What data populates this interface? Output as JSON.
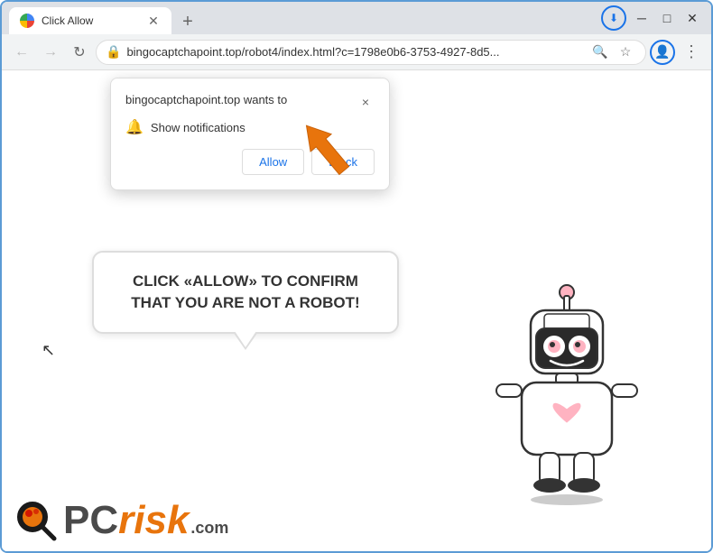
{
  "browser": {
    "tab": {
      "title": "Click Allow",
      "favicon_alt": "tab-favicon"
    },
    "new_tab_button": "+",
    "window_controls": {
      "minimize": "─",
      "maximize": "□",
      "close": "✕"
    },
    "address_bar": {
      "url": "bingocaptchapoint.top/robot4/index.html?c=1798e0b6-3753-4927-8d5...",
      "lock_icon": "🔒"
    },
    "nav": {
      "back": "←",
      "forward": "→",
      "refresh": "↻"
    }
  },
  "notification_popup": {
    "site_text": "bingocaptchapoint.top wants to",
    "close_icon": "×",
    "notification_label": "Show notifications",
    "allow_button": "Allow",
    "block_button": "Block"
  },
  "speech_bubble": {
    "text": "CLICK «ALLOW» TO CONFIRM THAT YOU ARE NOT A ROBOT!"
  },
  "logo": {
    "pc": "PC",
    "risk": "risk",
    "com": ".com"
  },
  "colors": {
    "orange": "#e8740c",
    "blue": "#1a73e8",
    "dark": "#4a4a4a"
  }
}
